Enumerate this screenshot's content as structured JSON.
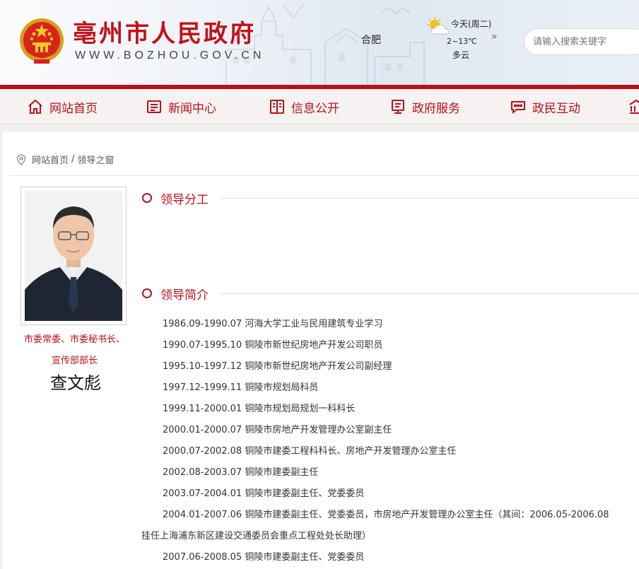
{
  "header": {
    "site_name": "亳州市人民政府",
    "site_domain": "WWW.BOZHOU.GOV.CN",
    "city": "合肥",
    "weather": {
      "today": "今天(周二)",
      "temperature": "2~13℃",
      "description": "多云",
      "icon": "partly-cloudy-icon"
    },
    "more_symbol": "»",
    "search_placeholder": "请输入搜索关键字"
  },
  "nav": {
    "items": [
      {
        "label": "网站首页",
        "icon": "home-icon"
      },
      {
        "label": "新闻中心",
        "icon": "news-icon"
      },
      {
        "label": "信息公开",
        "icon": "book-icon"
      },
      {
        "label": "政府服务",
        "icon": "monitor-icon"
      },
      {
        "label": "政民互动",
        "icon": "chat-icon"
      }
    ]
  },
  "breadcrumb": {
    "home": "网站首页",
    "separator": "/",
    "current": "领导之窗"
  },
  "leader": {
    "title_line1": "市委常委、市委秘书长、",
    "title_line2": "宣传部部长",
    "name": "查文彪"
  },
  "sections": {
    "division": "领导分工",
    "profile": "领导简介"
  },
  "resume": [
    "1986.09-1990.07 河海大学工业与民用建筑专业学习",
    "1990.07-1995.10 铜陵市新世纪房地产开发公司职员",
    "1995.10-1997.12 铜陵市新世纪房地产开发公司副经理",
    "1997.12-1999.11 铜陵市规划局科员",
    "1999.11-2000.01 铜陵市规划局规划一科科长",
    "2000.01-2000.07 铜陵市房地产开发管理办公室副主任",
    "2000.07-2002.08 铜陵市建委工程科科长、房地产开发管理办公室主任",
    "2002.08-2003.07 铜陵市建委副主任",
    "2003.07-2004.01 铜陵市建委副主任、党委委员",
    "2004.01-2007.06 铜陵市建委副主任、党委委员，市房地产开发管理办公室主任（其间：2006.05-2006.08",
    "挂任上海浦东新区建设交通委员会重点工程处处长助理）",
    "2007.06-2008.05 铜陵市建委副主任、党委委员"
  ],
  "colors": {
    "brand_red": "#b5121b",
    "title_red": "#c3111a"
  }
}
